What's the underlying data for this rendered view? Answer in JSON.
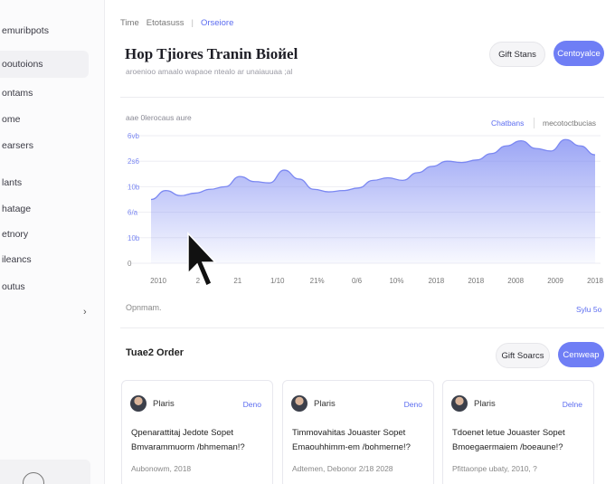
{
  "sidebar": {
    "items": [
      {
        "label": "emuribpots",
        "active": false
      },
      {
        "label": "ooutoions",
        "active": true
      },
      {
        "label": "ontams",
        "active": false
      },
      {
        "label": "ome",
        "active": false
      },
      {
        "label": "earsers",
        "active": false
      },
      {
        "label": "lants",
        "active": false
      },
      {
        "label": "hatage",
        "active": false
      },
      {
        "label": "etnory",
        "active": false
      },
      {
        "label": "ileancs",
        "active": false
      },
      {
        "label": "outus",
        "active": false
      }
    ],
    "chevron_icon": "chevron-right-icon",
    "bottom_icon": "settings-icon"
  },
  "breadcrumb": [
    "Time",
    "Etotasuss",
    "Orseiore"
  ],
  "header": {
    "title": "Hop Tjiores Tranin Bioйel",
    "subtitle": "aroenioo amaalo wapaoe ntealo ar unaiauuaa ;al",
    "secondary_button": "Gift Stans",
    "primary_button": "Centoyalce"
  },
  "chart_section": {
    "label": "aae 0lerocaus aure",
    "tab_active": "Chatbans",
    "tab_other": "mecotoctbucias",
    "footer_left": "Opnmam.",
    "footer_right": "Sylu 5o"
  },
  "chart_data": {
    "type": "area",
    "x_tick_labels": [
      "2010",
      "2",
      "21",
      "1/10",
      "21%",
      "0/6",
      "10%",
      "2018",
      "2018",
      "2008",
      "2009",
      "2018"
    ],
    "y_tick_labels": [
      "0",
      "10b",
      "6/a",
      "10b",
      "2s6",
      "6vb"
    ],
    "ylim": [
      0,
      100
    ],
    "values": [
      50,
      57,
      53,
      55,
      58,
      60,
      68,
      64,
      63,
      73,
      66,
      58,
      56,
      57,
      59,
      65,
      67,
      65,
      71,
      76,
      80,
      79,
      81,
      86,
      92,
      96,
      90,
      88,
      97,
      92,
      85
    ],
    "color": "#7b88f2"
  },
  "section2": {
    "title": "Tuae2 Order",
    "secondary_button": "Gift Soarcs",
    "primary_button": "Cenweap"
  },
  "cards": [
    {
      "name": "Plaris",
      "tag": "Deno",
      "text": "Qpenarattitaj Jedote Sopet Bmvarammuorm /bhmeman!?",
      "meta": "Aubonowm,  2018"
    },
    {
      "name": "Plaris",
      "tag": "Deno",
      "text": "Timmovahitas Jouaster Sopet Emaouhhimm-em /bohmerne!?",
      "meta": "Adtemen,  Debonor   2/18  2028"
    },
    {
      "name": "Plaris",
      "tag": "Delne",
      "text": "Tdoenet letue Jouaster Sopet Bmoegaermaiem /boeaune!?",
      "meta": "Pfittaonpe    ubaty, 2010, ?"
    }
  ]
}
